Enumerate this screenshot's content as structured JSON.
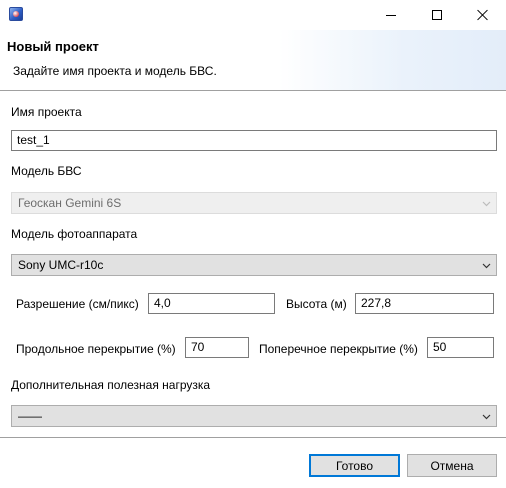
{
  "window": {
    "title_icon": "app-icon",
    "controls": {
      "minimize": "minimize-icon",
      "maximize": "maximize-icon",
      "close": "close-icon"
    }
  },
  "header": {
    "title": "Новый проект",
    "description": "Задайте имя проекта и модель БВС."
  },
  "form": {
    "project_name_label": "Имя проекта",
    "project_name_value": "test_1",
    "uav_model_label": "Модель БВС",
    "uav_model_value": "Геоскан Gemini 6S",
    "camera_model_label": "Модель фотоаппарата",
    "camera_model_value": "Sony UMC-r10c",
    "resolution_label": "Разрешение (см/пикс)",
    "resolution_value": "4,0",
    "altitude_label": "Высота (м)",
    "altitude_value": "227,8",
    "forward_overlap_label": "Продольное перекрытие (%)",
    "forward_overlap_value": "70",
    "side_overlap_label": "Поперечное перекрытие (%)",
    "side_overlap_value": "50",
    "payload_label": "Дополнительная полезная нагрузка",
    "payload_value": "——"
  },
  "buttons": {
    "ok": "Готово",
    "cancel": "Отмена"
  },
  "colors": {
    "default_button_border": "#0078d7",
    "separator": "#a0a0a0"
  }
}
